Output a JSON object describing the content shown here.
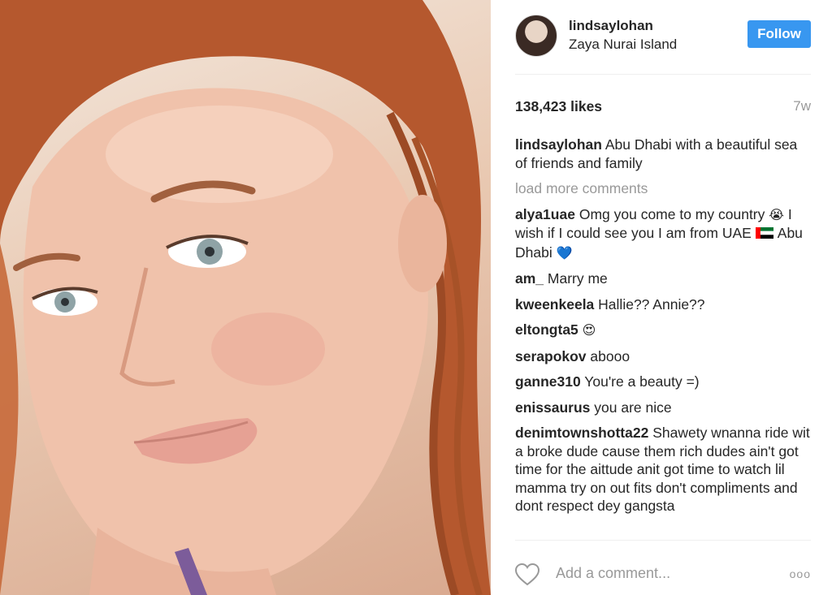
{
  "post": {
    "photo_alt": "",
    "header": {
      "username": "lindsaylohan",
      "location": "Zaya Nurai Island",
      "follow_label": "Follow"
    },
    "likes": "138,423 likes",
    "time": "7w",
    "caption": {
      "user": "lindsaylohan",
      "text": "Abu Dhabi with a beautiful sea of friends and family"
    },
    "load_more": "load more comments",
    "comments": [
      {
        "user": "alya1uae",
        "text_a": "Omg you come to my country",
        "text_b": "I wish if I could see you I am from UAE",
        "text_c": "Abu Dhabi"
      },
      {
        "user": "am_",
        "text": "Marry me"
      },
      {
        "user": "kweenkeela",
        "text": "Hallie?? Annie??"
      },
      {
        "user": "eltongta5",
        "text": ""
      },
      {
        "user": "serapokov",
        "text": "abooo"
      },
      {
        "user": "ganne310",
        "text": "You're a beauty =)"
      },
      {
        "user": "enissaurus",
        "text": "you are nice"
      },
      {
        "user": "denimtownshotta22",
        "text": "Shawety wnanna ride wit a broke dude cause them rich dudes ain't got time for the aittude anit got time to watch lil mamma try on out fits don't compliments and dont respect dey gangsta"
      }
    ],
    "footer": {
      "add_comment_placeholder": "Add a comment...",
      "more_label": "ooo"
    },
    "icons": {
      "heart": "heart-outline-icon",
      "crying_emoji": "crying-face-emoji",
      "flag": "uae-flag-emoji",
      "blue_heart": "blue-heart-emoji",
      "heart_eyes": "heart-eyes-emoji"
    },
    "colors": {
      "follow_button": "#3897f0",
      "muted_text": "#999999",
      "text": "#262626"
    }
  }
}
